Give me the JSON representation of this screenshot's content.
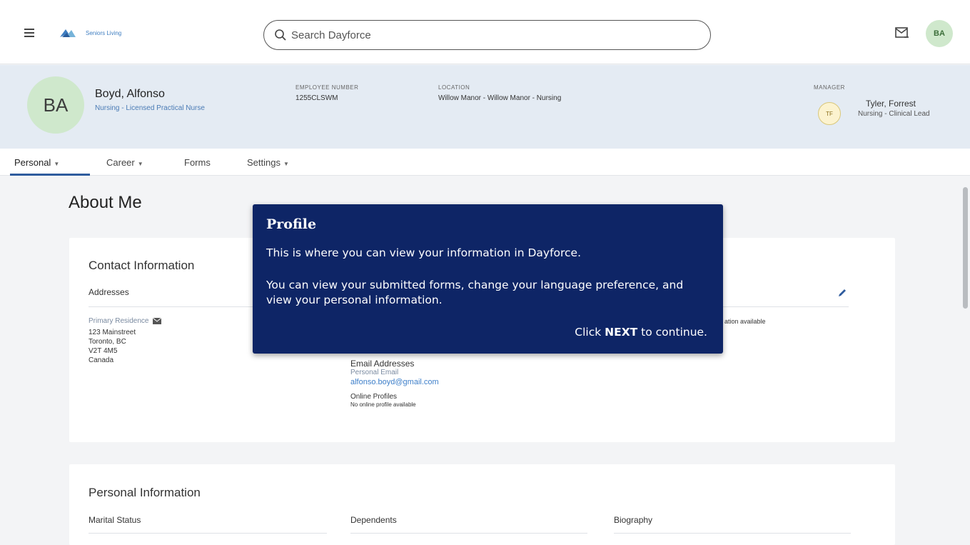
{
  "topbar": {
    "search_placeholder": "Search Dayforce",
    "logo_text": "Seniors Living",
    "avatar_initials": "BA"
  },
  "employee": {
    "initials": "BA",
    "name": "Boyd, Alfonso",
    "role": "Nursing - Licensed Practical Nurse",
    "number_label": "EMPLOYEE NUMBER",
    "number": "1255CLSWM",
    "location_label": "LOCATION",
    "location": "Willow Manor - Willow Manor - Nursing",
    "manager_label": "MANAGER",
    "manager_initials": "TF",
    "manager_name": "Tyler, Forrest",
    "manager_role": "Nursing - Clinical Lead"
  },
  "tabs": [
    {
      "label": "Personal"
    },
    {
      "label": "Career"
    },
    {
      "label": "Forms"
    },
    {
      "label": "Settings"
    }
  ],
  "page": {
    "title": "About Me"
  },
  "contact": {
    "title": "Contact Information",
    "addresses_label": "Addresses",
    "primary_label": "Primary Residence",
    "address_line1": "123 Mainstreet",
    "address_line2": "Toronto, BC",
    "address_line3": "V2T 4M5",
    "address_line4": "Canada",
    "email_label": "Email Addresses",
    "personal_email_label": "Personal Email",
    "email": "alfonso.boyd@gmail.com",
    "online_label": "Online Profiles",
    "online_value": "No online profile available",
    "right_col_value": "ation available"
  },
  "personal": {
    "title": "Personal Information",
    "col1": "Marital Status",
    "col2": "Dependents",
    "col3": "Biography"
  },
  "popup": {
    "title": "Profile",
    "line1": "This is where you can view your information in Dayforce.",
    "line2": "You can view your submitted forms, change your language preference, and view your personal information.",
    "next_prefix": "Click ",
    "next_word": "NEXT",
    "next_suffix": " to continue."
  },
  "colors": {
    "popup_bg": "#0e2566",
    "header_bg": "#e4ebf3",
    "avatar_bg": "#cfe8cc",
    "accent": "#2f5c9e"
  }
}
